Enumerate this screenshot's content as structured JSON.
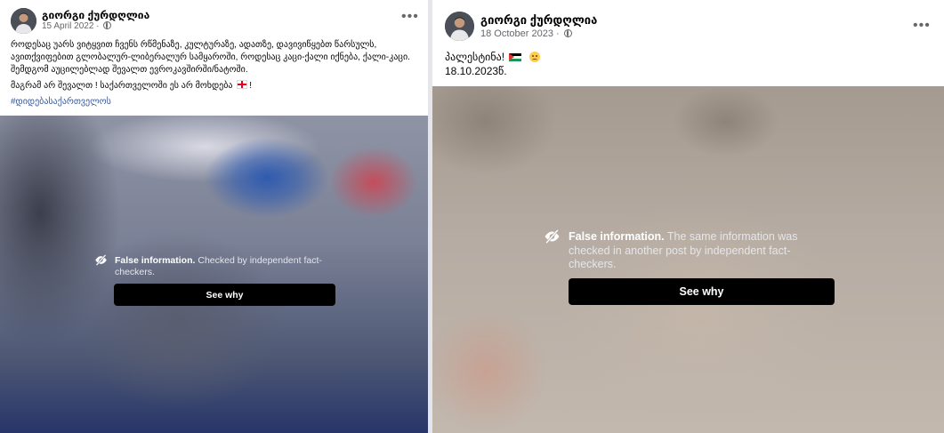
{
  "posts": [
    {
      "author": "გიორგი ქურდღლია",
      "date": "15 April 2022 ·",
      "caption_line1": "როდესაც უარს ვიტყვით ჩვენს რწმენაზე, კულტურაზე, ადათზე, დავივიწყებთ წარსულს, ავითქვიფებით გლობალურ-ლიბერალურ სამყაროში, როდესაც კაცი-ქალი იქნება, ქალი-კაცი. შემდგომ აუცილებლად შევალთ ევროკავშირში/ნატოში.",
      "caption_line2": "მაგრამ არ შევალთ ! საქართველოში ეს არ მოხდება",
      "caption_line2_end": "!",
      "hashtag": "#დიდებასაქართველოს",
      "warning_title": "False information.",
      "warning_body": "Checked by independent fact-checkers.",
      "button": "See why"
    },
    {
      "author": "გიორგი ქურდღლია",
      "date": "18 October 2023 ·",
      "caption_line1": "პალესტინა!",
      "caption_line2": "18.10.2023წ.",
      "warning_title": "False information.",
      "warning_body": "The same information was checked in another post by independent fact-checkers.",
      "button": "See why"
    }
  ],
  "icons": {
    "more": "more-horizontal-icon",
    "privacy": "globe-icon",
    "warning": "eye-slash-icon"
  },
  "colors": {
    "button_bg": "#000000",
    "meta_text": "#65676b",
    "hashtag": "#385898"
  }
}
